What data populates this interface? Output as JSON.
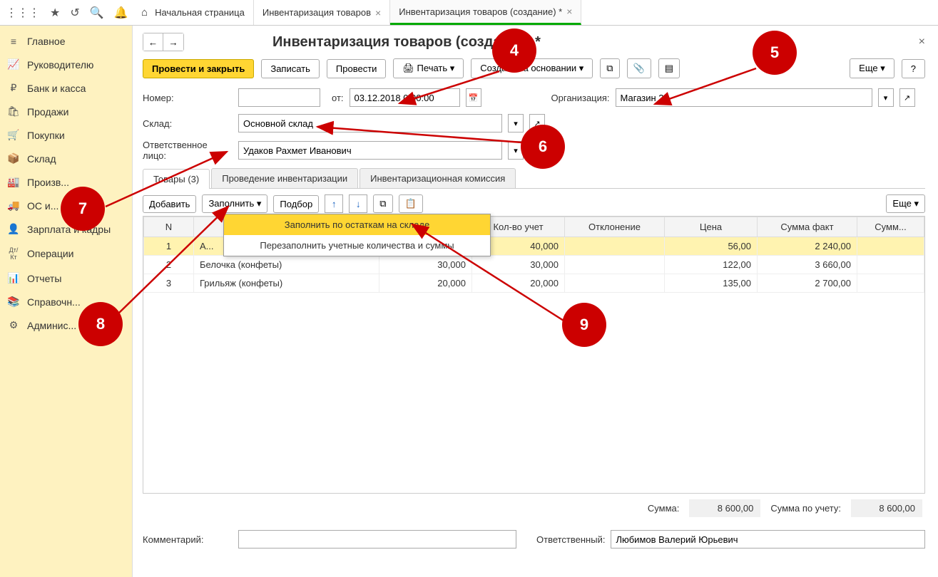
{
  "topIcons": [
    "⋮⋮⋮",
    "★",
    "↺",
    "🔍",
    "🔔"
  ],
  "tabs": [
    {
      "label": "Начальная страница",
      "home": true,
      "active": false
    },
    {
      "label": "Инвентаризация товаров",
      "active": false
    },
    {
      "label": "Инвентаризация товаров (создание) *",
      "active": true
    }
  ],
  "sidebar": [
    {
      "icon": "≡",
      "label": "Главное"
    },
    {
      "icon": "📈",
      "label": "Руководителю"
    },
    {
      "icon": "₽",
      "label": "Банк и касса"
    },
    {
      "icon": "🛍",
      "label": "Продажи"
    },
    {
      "icon": "🛒",
      "label": "Покупки"
    },
    {
      "icon": "📦",
      "label": "Склад"
    },
    {
      "icon": "🏭",
      "label": "Произв..."
    },
    {
      "icon": "🚚",
      "label": "ОС и..."
    },
    {
      "icon": "👤",
      "label": "Зарплата и кадры"
    },
    {
      "icon": "Дт/Кт",
      "label": "Операции"
    },
    {
      "icon": "📊",
      "label": "Отчеты"
    },
    {
      "icon": "📚",
      "label": "Справочн..."
    },
    {
      "icon": "⚙",
      "label": "Админис..."
    }
  ],
  "pageTitle": "Инвентаризация товаров (создание) *",
  "actions": {
    "postClose": "Провести и закрыть",
    "save": "Записать",
    "post": "Провести",
    "print": "Печать",
    "createBased": "Создать на основании",
    "more": "Еще",
    "help": "?"
  },
  "form": {
    "numberLabel": "Номер:",
    "numberValue": "",
    "fromLabel": "от:",
    "dateValue": "03.12.2018 0:00:00",
    "orgLabel": "Организация:",
    "orgValue": "Магазин 23",
    "warehouseLabel": "Склад:",
    "warehouseValue": "Основной склад",
    "responsibleLabel": "Ответственное лицо:",
    "responsibleValue": "Удаков Рахмет Иванович"
  },
  "subtabs": [
    "Товары (3)",
    "Проведение инвентаризации",
    "Инвентаризационная комиссия"
  ],
  "tableToolbar": {
    "add": "Добавить",
    "fill": "Заполнить",
    "select": "Подбор",
    "more": "Еще"
  },
  "dropdown": {
    "fillByStock": "Заполнить по остаткам на складе",
    "refill": "Перезаполнить учетные количества и суммы"
  },
  "table": {
    "headers": [
      "N",
      "Н...",
      "...",
      "Кол-во учет",
      "Отклонение",
      "Цена",
      "Сумма факт",
      "Сумм..."
    ],
    "rows": [
      {
        "n": 1,
        "name": "А...",
        "qty_fact": "",
        "qty_acc": "40,000",
        "dev": "",
        "price": "56,00",
        "sum_fact": "2 240,00",
        "hl": true
      },
      {
        "n": 2,
        "name": "Белочка (конфеты)",
        "qty_fact": "30,000",
        "qty_acc": "30,000",
        "dev": "",
        "price": "122,00",
        "sum_fact": "3 660,00",
        "hl": false
      },
      {
        "n": 3,
        "name": "Грильяж (конфеты)",
        "qty_fact": "20,000",
        "qty_acc": "20,000",
        "dev": "",
        "price": "135,00",
        "sum_fact": "2 700,00",
        "hl": false
      }
    ]
  },
  "totals": {
    "sumLabel": "Сумма:",
    "sumValue": "8 600,00",
    "sumAccLabel": "Сумма по учету:",
    "sumAccValue": "8 600,00"
  },
  "footer": {
    "commentLabel": "Комментарий:",
    "commentValue": "",
    "responsibleLabel": "Ответственный:",
    "responsibleValue": "Любимов Валерий Юрьевич"
  },
  "callouts": {
    "c4": "4",
    "c5": "5",
    "c6": "6",
    "c7": "7",
    "c8": "8",
    "c9": "9"
  }
}
